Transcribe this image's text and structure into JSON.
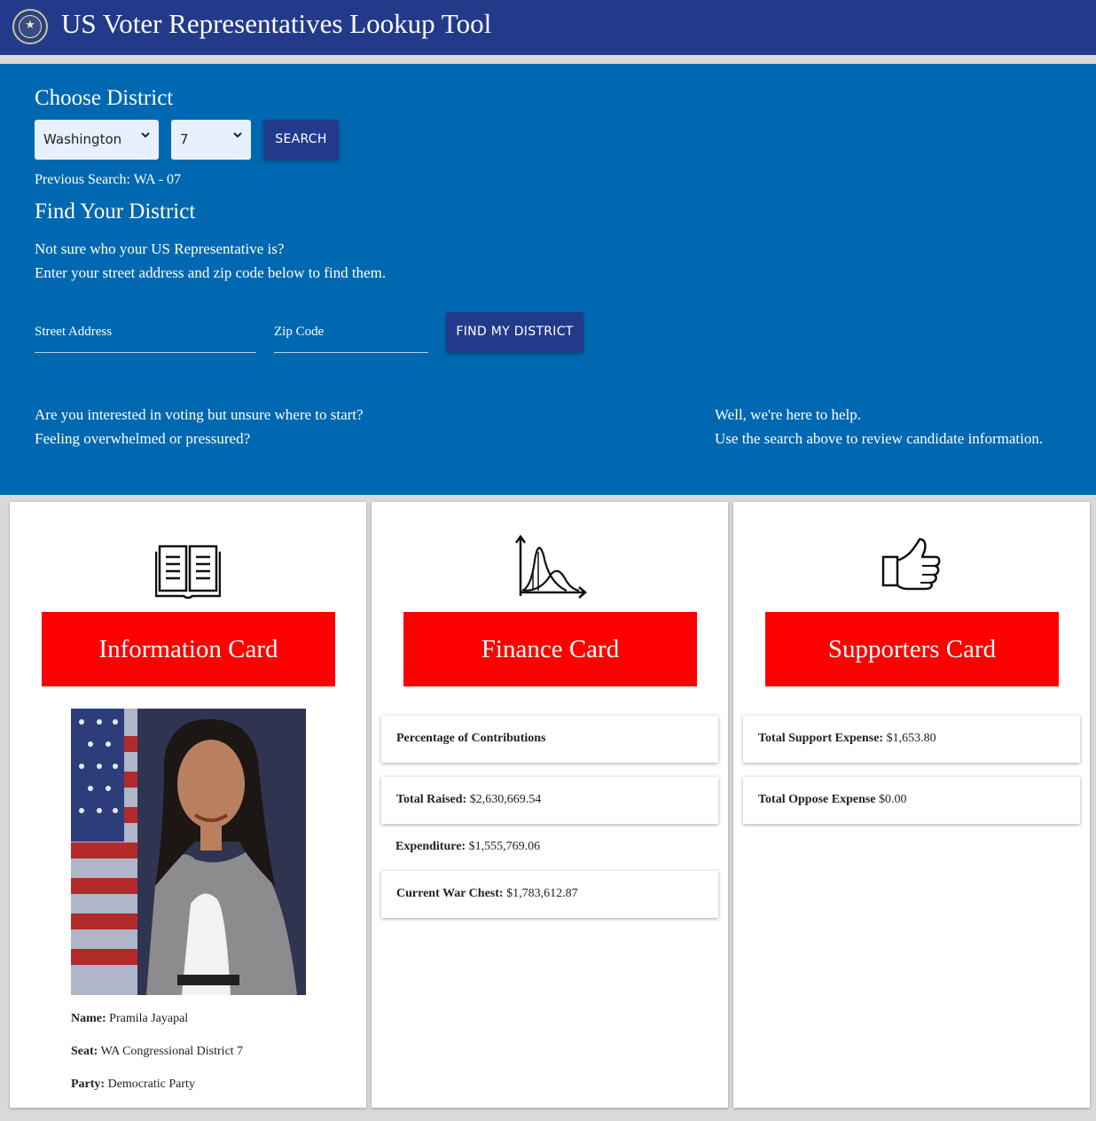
{
  "header": {
    "title": "US Voter Representatives Lookup Tool",
    "seal_icon": "house-seal-icon"
  },
  "choose": {
    "heading": "Choose District",
    "state_value": "Washington",
    "district_value": "7",
    "search_label": "SEARCH",
    "previous_search": "Previous Search: WA - 07"
  },
  "find": {
    "heading": "Find Your District",
    "line1": "Not sure who your US Representative is?",
    "line2": "Enter your street address and zip code below to find them.",
    "street_placeholder": "Street Address",
    "zip_placeholder": "Zip Code",
    "button_label": "FIND MY DISTRICT"
  },
  "intro": {
    "left1": "Are you interested in voting but unsure where to start?",
    "left2": "Feeling overwhelmed or pressured?",
    "right1": "Well, we're here to help.",
    "right2": "Use the search above to review candidate information."
  },
  "info_card": {
    "icon": "open-book-icon",
    "title": "Information Card",
    "name_label": "Name:",
    "name_value": " Pramila Jayapal",
    "seat_label": "Seat:",
    "seat_value": " WA Congressional District 7",
    "party_label": "Party:",
    "party_value": " Democratic Party"
  },
  "finance_card": {
    "icon": "distribution-chart-icon",
    "title": "Finance Card",
    "pct_label": "Percentage of Contributions",
    "raised_label": "Total Raised:",
    "raised_value": " $2,630,669.54",
    "expend_label": "Expenditure:",
    "expend_value": " $1,555,769.06",
    "chest_label": "Current War Chest:",
    "chest_value": " $1,783,612.87"
  },
  "supporters_card": {
    "icon": "thumbs-up-icon",
    "title": "Supporters Card",
    "support_label": "Total Support Expense:",
    "support_value": " $1,653.80",
    "oppose_label": "Total Oppose Expense",
    "oppose_value": " $0.00"
  },
  "colors": {
    "header": "#233a8b",
    "hero": "#0068b0",
    "banner": "#ff0000",
    "button": "#233a8b"
  }
}
